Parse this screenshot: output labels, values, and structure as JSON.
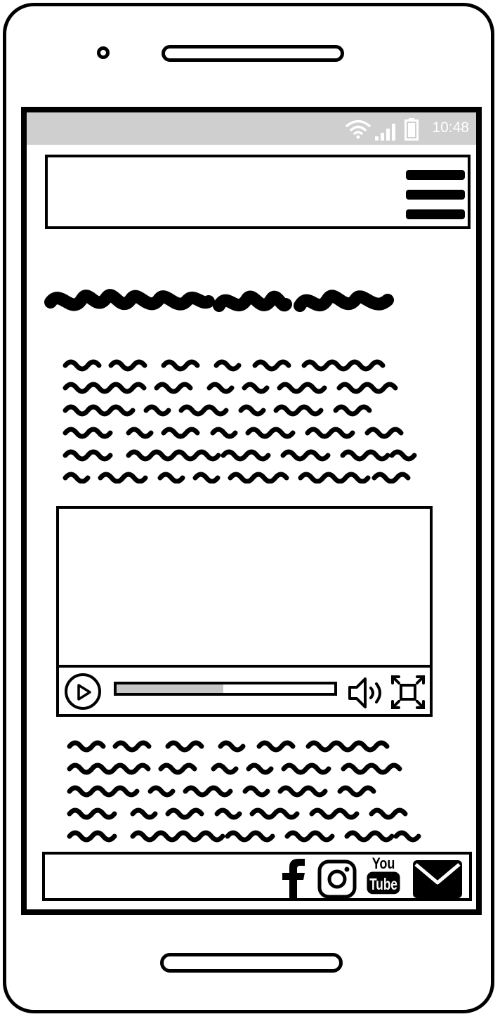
{
  "status_bar": {
    "time": "10:48",
    "icons": [
      "wifi-icon",
      "signal-icon",
      "battery-icon"
    ]
  },
  "header": {
    "menu_icon": "hamburger-menu-icon"
  },
  "video_player": {
    "progress_percent": 49,
    "controls": [
      "play-icon",
      "progress-bar",
      "volume-icon",
      "fullscreen-icon"
    ]
  },
  "footer": {
    "social_icons": [
      "facebook-icon",
      "instagram-icon",
      "youtube-icon",
      "email-icon"
    ],
    "youtube_text_top": "You",
    "youtube_text_bottom": "Tube"
  },
  "colors": {
    "ink": "#000000",
    "status_bar_bg": "#cfcfcf",
    "progress_fill": "#c6c6c6",
    "background": "#ffffff"
  }
}
